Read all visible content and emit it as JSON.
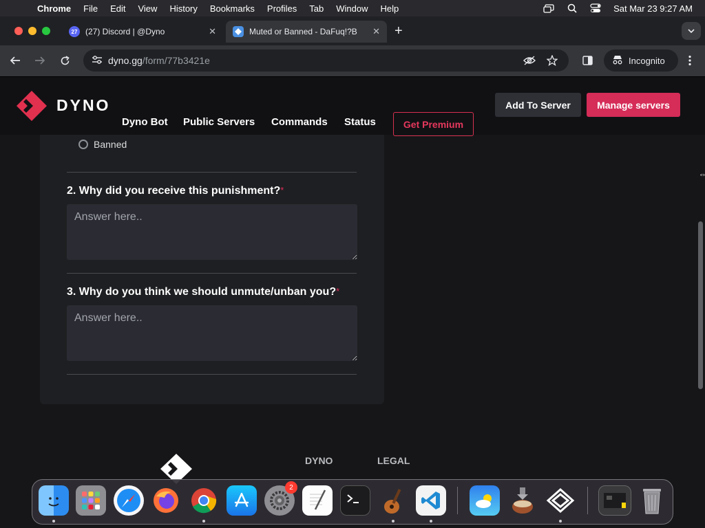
{
  "menubar": {
    "app_name": "Chrome",
    "items": [
      "File",
      "Edit",
      "View",
      "History",
      "Bookmarks",
      "Profiles",
      "Tab",
      "Window",
      "Help"
    ],
    "clock": "Sat Mar 23  9:27 AM"
  },
  "tabs": [
    {
      "title": "(27) Discord | @Dyno",
      "favicon_text": "27",
      "favicon_color": "#5865f2"
    },
    {
      "title": "Muted or Banned - DaFuq!?B",
      "favicon_color": "#4a90e2"
    }
  ],
  "toolbar": {
    "url_host": "dyno.gg",
    "url_path": "/form/77b3421e",
    "profile_label": "Incognito"
  },
  "site": {
    "brand": "DYNO",
    "nav": [
      "Dyno Bot",
      "Public Servers",
      "Commands",
      "Status"
    ],
    "premium_label": "Get Premium",
    "add_to_server_label": "Add To Server",
    "manage_servers_label": "Manage servers"
  },
  "form": {
    "radio_option": "Banned",
    "questions": [
      {
        "label": "2. Why did you receive this punishment?",
        "required_mark": "*",
        "placeholder": "Answer here.."
      },
      {
        "label": "3. Why do you think we should unmute/unban you?",
        "required_mark": "*",
        "placeholder": "Answer here.."
      }
    ]
  },
  "footer": {
    "links": [
      "DYNO",
      "LEGAL"
    ]
  },
  "dock": {
    "settings_badge": "2",
    "apps": [
      "finder-icon",
      "launchpad-icon",
      "safari-icon",
      "firefox-icon",
      "chrome-icon",
      "app-store-icon",
      "system-settings-icon",
      "textedit-icon",
      "terminal-icon",
      "garageband-icon",
      "vscode-icon",
      "weather-icon",
      "installer-icon",
      "app-icon",
      "preview-icon",
      "trash-icon"
    ]
  },
  "colors": {
    "accent": "#d52c58",
    "page_bg": "#161618",
    "card_bg": "#1e1f22"
  }
}
